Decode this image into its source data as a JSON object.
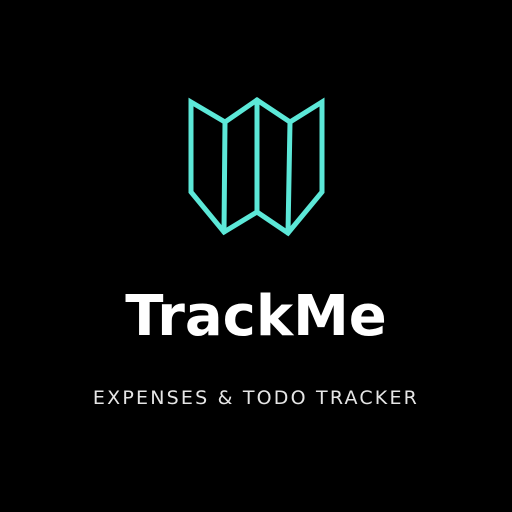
{
  "brand": {
    "name": "TrackMe",
    "tagline": "EXPENSES & TODO TRACKER",
    "logo_icon": "folded-map-icon",
    "accent_color": "#5ce8d8",
    "background_color": "#000000",
    "text_color": "#ffffff"
  }
}
